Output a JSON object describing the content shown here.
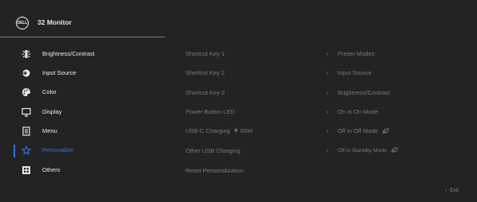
{
  "header": {
    "logo_text": "DELL",
    "title": "32 Monitor"
  },
  "menu": {
    "items": [
      {
        "label": "Brightness/Contrast",
        "icon": "brightness-icon"
      },
      {
        "label": "Input Source",
        "icon": "input-source-icon"
      },
      {
        "label": "Color",
        "icon": "color-icon"
      },
      {
        "label": "Display",
        "icon": "display-icon"
      },
      {
        "label": "Menu",
        "icon": "menu-icon"
      },
      {
        "label": "Personalize",
        "icon": "star-icon",
        "selected": true
      },
      {
        "label": "Others",
        "icon": "others-icon"
      }
    ]
  },
  "submenu": {
    "rows": [
      {
        "label": "Shortcut Key 1",
        "value": "Preset Modes"
      },
      {
        "label": "Shortcut Key 2",
        "value": "Input Source"
      },
      {
        "label": "Shortcut Key 3",
        "value": "Brightness/Contrast"
      },
      {
        "label": "Power Button LED",
        "value": "On in On Mode"
      },
      {
        "label": "USB-C Charging",
        "charging_watts": "65W",
        "value": "Off in Off Mode"
      },
      {
        "label": "Other USB Charging",
        "value": "Off in Standby Mode"
      },
      {
        "label": "Reset Personalization"
      }
    ]
  },
  "footer": {
    "exit_label": "Exit"
  },
  "colors": {
    "accent": "#2a79d4",
    "background": "#232323",
    "dim_text": "#7a7a7a"
  }
}
